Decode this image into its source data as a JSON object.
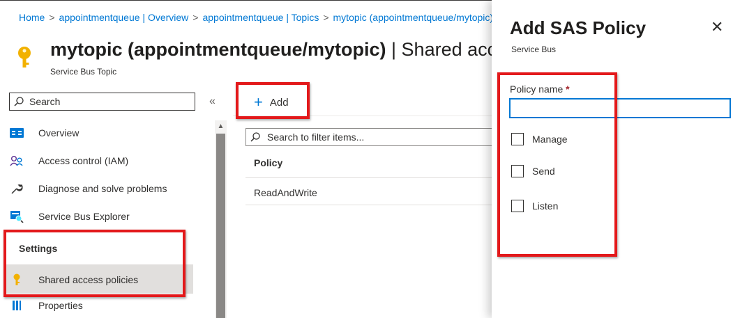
{
  "breadcrumb": {
    "items": [
      "Home",
      "appointmentqueue | Overview",
      "appointmentqueue | Topics",
      "mytopic (appointmentqueue/mytopic)"
    ],
    "separator": ">"
  },
  "page": {
    "title_main": "mytopic (appointmentqueue/mytopic)",
    "title_rest": " | Shared access policies",
    "subtitle": "Service Bus Topic"
  },
  "sidebar": {
    "search_text": "Search",
    "collapse_glyph": "«",
    "items": [
      {
        "label": "Overview",
        "icon": "overview-icon"
      },
      {
        "label": "Access control (IAM)",
        "icon": "people-icon"
      },
      {
        "label": "Diagnose and solve problems",
        "icon": "wrench-icon"
      },
      {
        "label": "Service Bus Explorer",
        "icon": "explorer-icon"
      }
    ],
    "settings_header": "Settings",
    "settings_items": [
      {
        "label": "Shared access policies",
        "icon": "key-icon",
        "selected": true
      },
      {
        "label": "Properties",
        "icon": "properties-icon"
      }
    ]
  },
  "toolbar": {
    "add_label": "Add",
    "add_icon": "plus-icon"
  },
  "filter": {
    "placeholder": "Search to filter items..."
  },
  "table": {
    "columns": [
      "Policy"
    ],
    "rows": [
      [
        "ReadAndWrite"
      ]
    ]
  },
  "panel": {
    "title": "Add SAS Policy",
    "subtitle": "Service Bus",
    "close_glyph": "✕",
    "policy_name_label": "Policy name",
    "required_mark": "*",
    "policy_name_value": "",
    "checkboxes": [
      {
        "label": "Manage",
        "checked": false
      },
      {
        "label": "Send",
        "checked": false
      },
      {
        "label": "Listen",
        "checked": false
      }
    ]
  },
  "colors": {
    "accent": "#0078d4",
    "highlight": "#e3191b",
    "key_gold": "#f2b100",
    "selected_bg": "#e1dfdd"
  }
}
